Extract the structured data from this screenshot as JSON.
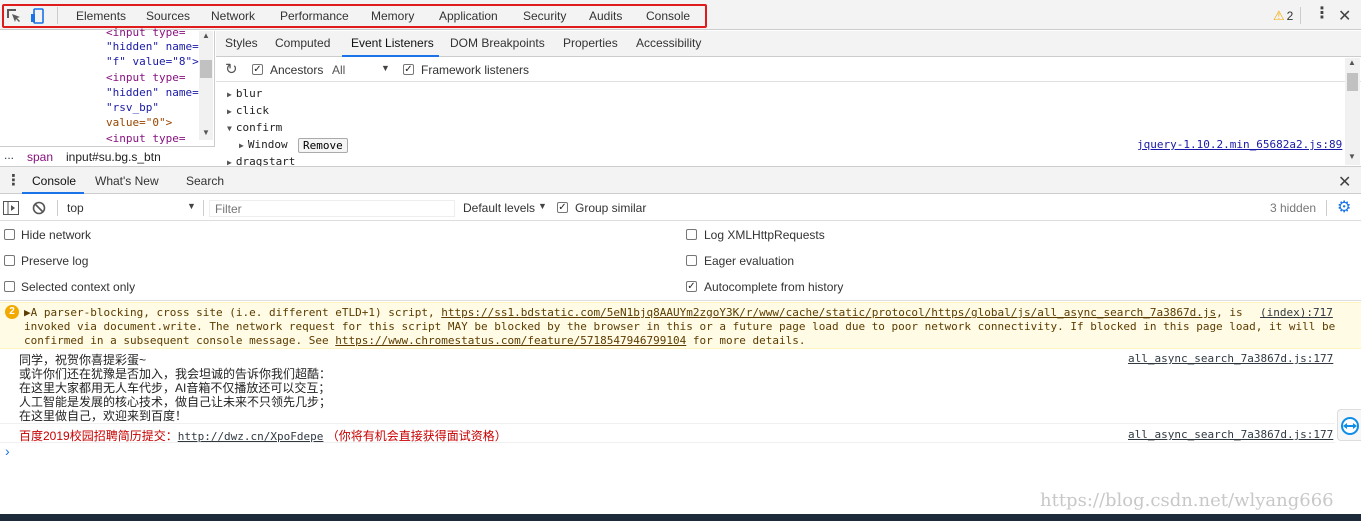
{
  "main_tabs": [
    "Elements",
    "Sources",
    "Network",
    "Performance",
    "Memory",
    "Application",
    "Security",
    "Audits",
    "Console"
  ],
  "warnings_count": "2",
  "dom_lines": [
    {
      "parts": [
        "<input type="
      ]
    },
    {
      "parts": [
        "\"hidden\" name="
      ]
    },
    {
      "parts": [
        "\"f\" value=\"8\">"
      ]
    },
    {
      "parts": [
        "<input type="
      ]
    },
    {
      "parts": [
        "\"hidden\" name="
      ]
    },
    {
      "parts": [
        "\"rsv_bp\""
      ]
    },
    {
      "parts": [
        "value=\"0\">"
      ]
    },
    {
      "parts": [
        "<input type="
      ]
    }
  ],
  "breadcrumbs": {
    "ellipsis": "...",
    "items": [
      "span",
      "input#su.bg.s_btn"
    ]
  },
  "sub_tabs": [
    "Styles",
    "Computed",
    "Event Listeners",
    "DOM Breakpoints",
    "Properties",
    "Accessibility"
  ],
  "listener_toolbar": {
    "ancestors": "Ancestors",
    "scope": "All",
    "framework": "Framework listeners"
  },
  "events": {
    "blur": "blur",
    "click": "click",
    "confirm": "confirm",
    "window": "Window",
    "remove": "Remove",
    "dragstart": "dragstart",
    "source": "jquery-1.10.2.min_65682a2.js:89"
  },
  "drawer_tabs": [
    "Console",
    "What's New",
    "Search"
  ],
  "console_toolbar": {
    "context": "top",
    "filter_placeholder": "Filter",
    "levels": "Default levels",
    "group_similar": "Group similar",
    "hidden": "3 hidden"
  },
  "settings": {
    "hide_network": "Hide network",
    "preserve_log": "Preserve log",
    "selected_context": "Selected context only",
    "log_xhr": "Log XMLHttpRequests",
    "eager_eval": "Eager evaluation",
    "autocomplete": "Autocomplete from history"
  },
  "warning": {
    "count": "2",
    "line1_pre": "▶A parser-blocking, cross site (i.e. different eTLD+1) script, ",
    "line1_link": "https://ss1.bdstatic.com/5eN1bjq8AAUYm2zgoY3K/r/www/cache/static/protocol/https/global/js/all_async_search_7a3867d.js",
    "line1_post": ", is",
    "source": "(index):717",
    "line2": "invoked via document.write. The network request for this script MAY be blocked by the browser in this or a future page load due to poor network connectivity. If blocked in this page load, it will be",
    "line3_pre": "confirmed in a subsequent console message. See ",
    "line3_link": "https://www.chromestatus.com/feature/5718547946799104",
    "line3_post": " for more details."
  },
  "log": {
    "lines": [
      "同学，祝贺你喜提彩蛋~",
      "或许你们还在犹豫是否加入，我会坦诚的告诉你我们超酷：",
      "在这里大家都用无人车代步，AI音箱不仅播放还可以交互；",
      "人工智能是发展的核心技术，做自己让未来不只领先几步；",
      "在这里做自己，欢迎来到百度！"
    ],
    "source": "all_async_search_7a3867d.js:177"
  },
  "recruit": {
    "pre": "百度2019校园招聘简历提交：",
    "link": "http://dwz.cn/XpoFdepe",
    "post": " （你将有机会直接获得面试资格）",
    "source": "all_async_search_7a3867d.js:177"
  },
  "watermark": "https://blog.csdn.net/wlyang666",
  "colors": {
    "accent": "#1a73e8",
    "highlight": "#e01b1b",
    "warn_bg": "#fffbe5",
    "recruit": "#c80000"
  }
}
